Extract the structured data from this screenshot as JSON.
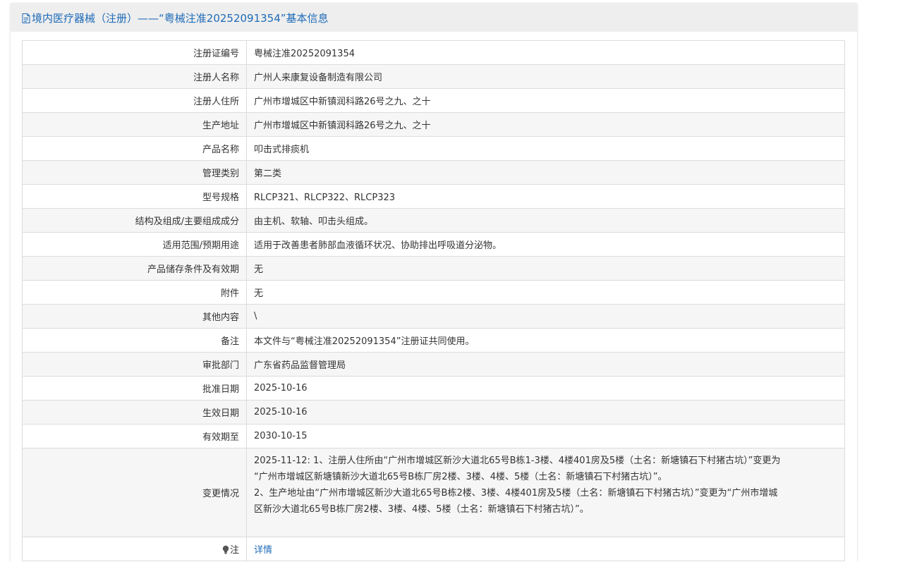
{
  "header": {
    "title": "境内医疗器械（注册）——“粤械注准20252091354”基本信息",
    "accent_color": "#1e6bb8",
    "icon": "document-icon"
  },
  "fields": {
    "reg_no": {
      "label": "注册证编号",
      "value": "粤械注准20252091354"
    },
    "registrant": {
      "label": "注册人名称",
      "value": "广州人来康复设备制造有限公司"
    },
    "reg_address": {
      "label": "注册人住所",
      "value": "广州市增城区中新镇润科路26号之九、之十"
    },
    "prod_address": {
      "label": "生产地址",
      "value": "广州市增城区中新镇润科路26号之九、之十"
    },
    "product": {
      "label": "产品名称",
      "value": "叩击式排痰机"
    },
    "category": {
      "label": "管理类别",
      "value": "第二类"
    },
    "model": {
      "label": "型号规格",
      "value": "RLCP321、RLCP322、RLCP323"
    },
    "structure": {
      "label": "结构及组成/主要组成成分",
      "value": "由主机、软轴、叩击头组成。"
    },
    "usage": {
      "label": "适用范围/预期用途",
      "value": "适用于改善患者肺部血液循环状况、协助排出呼吸道分泌物。"
    },
    "storage": {
      "label": "产品储存条件及有效期",
      "value": "无"
    },
    "attachment": {
      "label": "附件",
      "value": "无"
    },
    "other": {
      "label": "其他内容",
      "value": "\\"
    },
    "remark": {
      "label": "备注",
      "value": "本文件与“粤械注准20252091354”注册证共同使用。"
    },
    "authority": {
      "label": "审批部门",
      "value": "广东省药品监督管理局"
    },
    "approve_date": {
      "label": "批准日期",
      "value": "2025-10-16"
    },
    "effective_date": {
      "label": "生效日期",
      "value": "2025-10-16"
    },
    "valid_until": {
      "label": "有效期至",
      "value": "2030-10-15"
    },
    "changes": {
      "label": "变更情况",
      "lines": [
        "2025-11-12: 1、注册人住所由“广州市增城区新沙大道北65号B栋1-3楼、4楼401房及5楼（土名：新塘镇石下村猪古坑）”变更为",
        "“广州市增城区新塘镇新沙大道北65号B栋厂房2楼、3楼、4楼、5楼（土名：新塘镇石下村猪古坑）”。",
        "2、生产地址由“广州市增城区新沙大道北65号B栋2楼、3楼、4楼401房及5楼（土名：新塘镇石下村猪古坑）”变更为“广州市增城",
        "区新沙大道北65号B栋厂房2楼、3楼、4楼、5楼（土名：新塘镇石下村猪古坑）”。"
      ]
    },
    "note": {
      "label": "注",
      "link": "详情",
      "icon": "lightbulb-icon"
    }
  }
}
